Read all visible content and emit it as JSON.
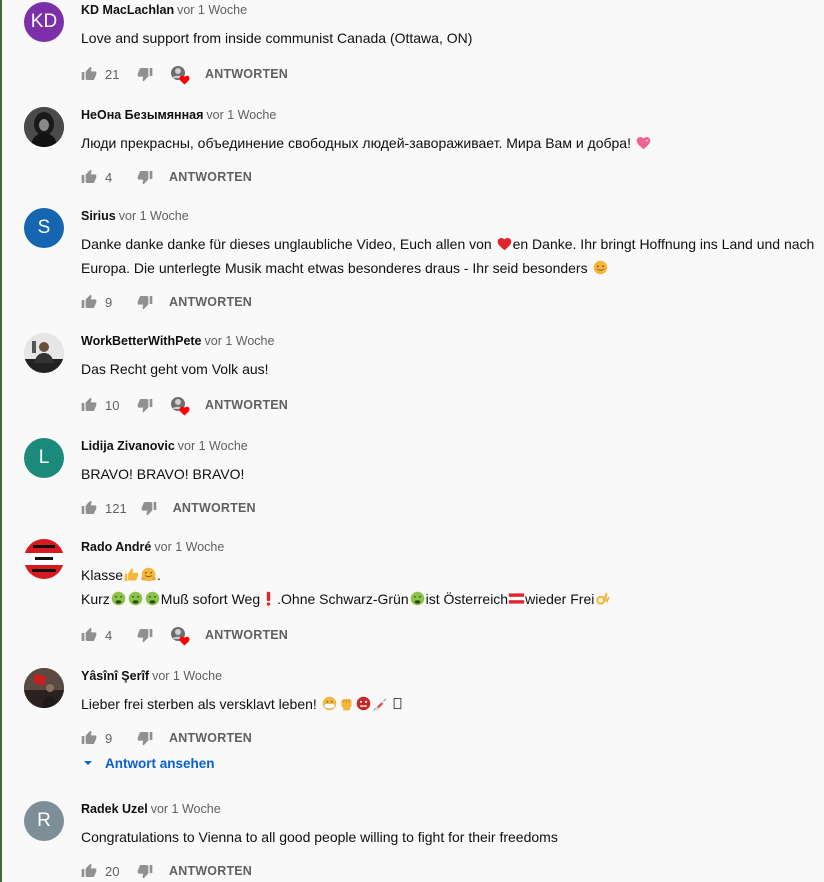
{
  "ui": {
    "reply_label": "ANTWORTEN",
    "view_replies_label": "Antwort ansehen"
  },
  "comments": [
    {
      "author": "KD MacLachlan",
      "time": "vor 1 Woche",
      "avatar_initials": "KD",
      "avatar_color": "#7b2fa8",
      "lines": [
        "Love and support from inside communist Canada (Ottawa, ON)"
      ],
      "likes": "21",
      "creator_heart": true
    },
    {
      "author": "НеОна Безымянная",
      "time": "vor 1 Woche",
      "avatar_initials": "",
      "avatar_color": "#2b2b2b",
      "lines": [
        "Люди прекрасны, объединение свободных людей-завораживает. Мира Вам и добра!"
      ],
      "likes": "4",
      "creator_heart": false
    },
    {
      "author": "Sirius",
      "time": "vor 1 Woche",
      "avatar_initials": "S",
      "avatar_color": "#1565b0",
      "lines": [
        "Danke danke danke für dieses unglaubliche Video, Euch allen von",
        "en Danke. Ihr bringt Hoffnung ins Land und nach",
        "Europa. Die unterlegte Musik macht  etwas besonderes draus - Ihr seid besonders"
      ],
      "likes": "9",
      "creator_heart": false
    },
    {
      "author": "WorkBetterWithPete",
      "time": "vor 1 Woche",
      "avatar_initials": "",
      "avatar_color": "#d8d8d8",
      "lines": [
        "Das Recht geht vom Volk aus!"
      ],
      "likes": "10",
      "creator_heart": true
    },
    {
      "author": "Lidija Zivanovic",
      "time": "vor 1 Woche",
      "avatar_initials": "L",
      "avatar_color": "#1b8a7a",
      "lines": [
        "BRAVO!  BRAVO! BRAVO!"
      ],
      "likes": "121",
      "creator_heart": false
    },
    {
      "author": "Rado André",
      "time": "vor 1 Woche",
      "avatar_initials": "",
      "avatar_color": "#ffffff",
      "lines": [
        "Klasse",
        "Kurz",
        "Muß sofort Weg",
        ".Ohne Schwarz-Grün",
        "ist Österreich",
        "wieder Frei"
      ],
      "likes": "4",
      "creator_heart": true
    },
    {
      "author": "Yâsînî Şerîf",
      "time": "vor 1 Woche",
      "avatar_initials": "",
      "avatar_color": "#3a2a2a",
      "lines": [
        "Lieber frei sterben als versklavt leben!"
      ],
      "likes": "9",
      "creator_heart": false
    },
    {
      "author": "Radek Uzel",
      "time": "vor 1 Woche",
      "avatar_initials": "R",
      "avatar_color": "#7d8e99",
      "lines": [
        "Congratulations to Vienna to all good people willing to fight for their freedoms"
      ],
      "likes": "20",
      "creator_heart": false
    }
  ],
  "icons": {
    "like": "thumb-up-icon",
    "dislike": "thumb-down-icon",
    "heart": "creator-heart-icon",
    "caret": "caret-down-icon"
  },
  "colors": {
    "link_blue": "#065fd4",
    "heart_red": "#ff0000"
  }
}
